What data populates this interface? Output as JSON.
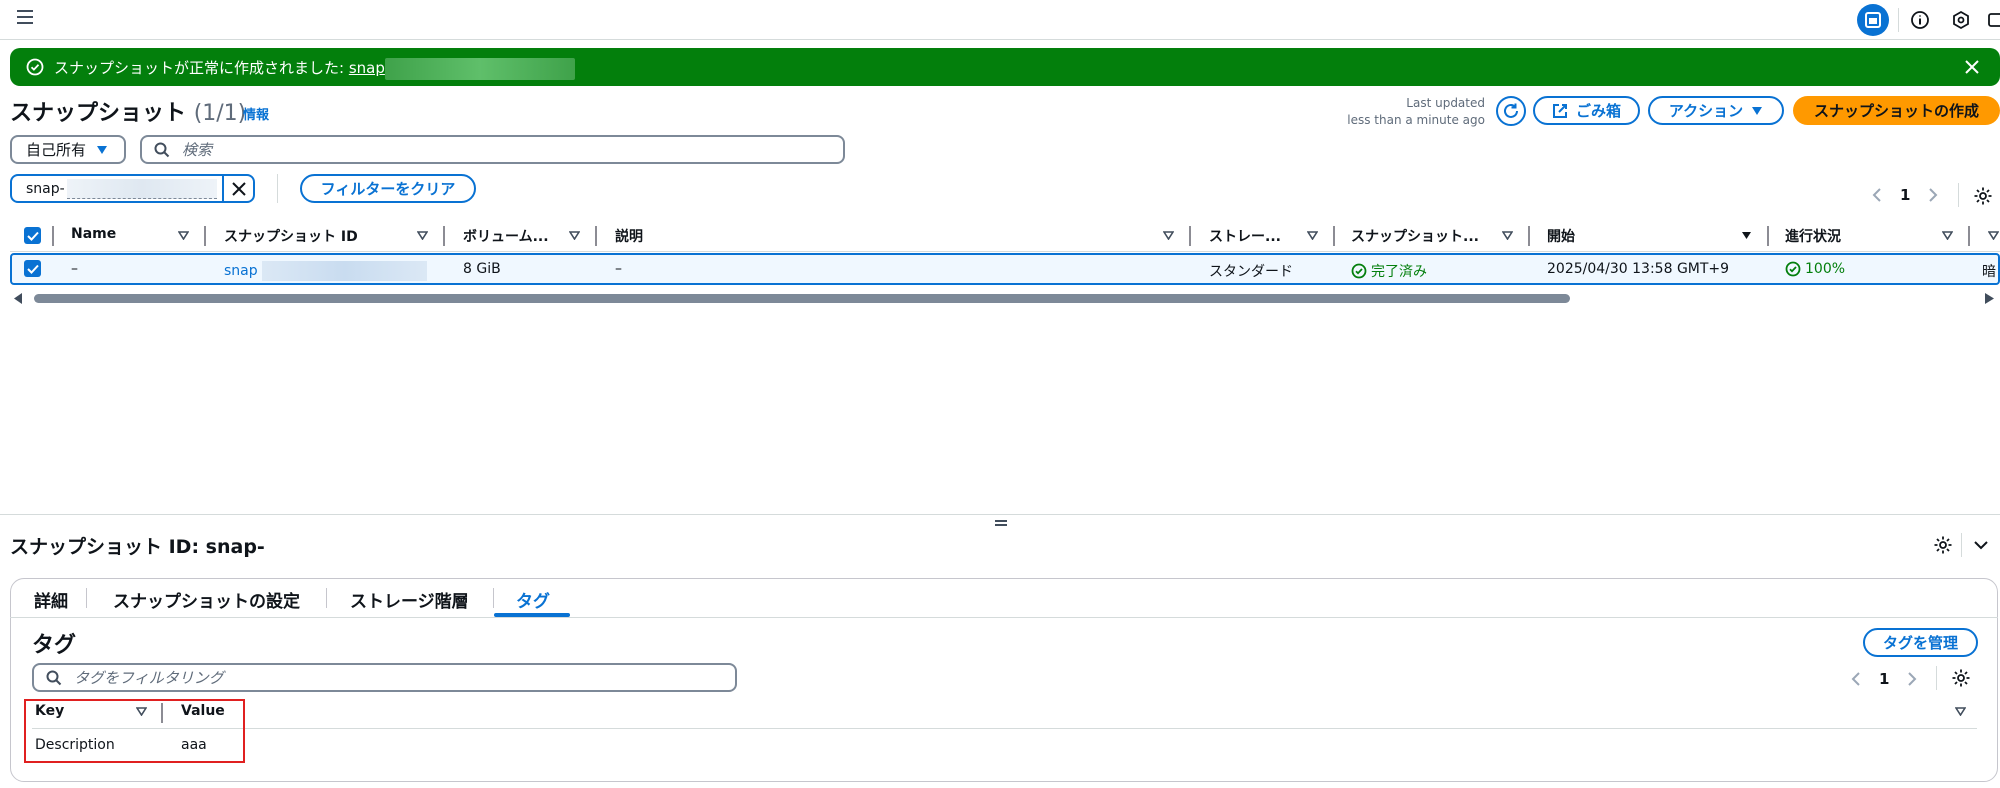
{
  "topbar": {
    "icons": [
      "menu-icon",
      "panel-icon",
      "info-icon",
      "hexagon-icon",
      "window-icon"
    ],
    "accent": "#0972d3"
  },
  "flash": {
    "message": "スナップショットが正常に作成されました: ",
    "link": "snap",
    "color": "#037f0c"
  },
  "header": {
    "title": "スナップショット",
    "count": "(1/1)",
    "info_link": "情報",
    "last_updated_label": "Last updated",
    "last_updated_value": "less than a minute ago",
    "recycle_bin_label": "ごみ箱",
    "actions_label": "アクション",
    "create_label": "スナップショットの作成",
    "create_color": "#ff9900"
  },
  "filters": {
    "owner_select": "自己所有",
    "search_placeholder": "検索",
    "token_prefix": "snap-",
    "clear_label": "フィルターをクリア"
  },
  "pagination": {
    "page": "1"
  },
  "table": {
    "columns": [
      "Name",
      "スナップショット ID",
      "ボリューム...",
      "説明",
      "ストレー...",
      "スナップショット...",
      "開始",
      "進行状況",
      ""
    ],
    "rows": [
      {
        "name": "–",
        "id_prefix": "snap",
        "volume_size": "8 GiB",
        "description": "–",
        "storage": "スタンダード",
        "status": "完了済み",
        "started": "2025/04/30 13:58 GMT+9",
        "progress": "100%",
        "truncated": "暗"
      }
    ]
  },
  "detail": {
    "title": "スナップショット ID: snap-",
    "tabs": [
      "詳細",
      "スナップショットの設定",
      "ストレージ階層",
      "タグ"
    ],
    "active_tab": "タグ",
    "tags_heading": "タグ",
    "manage_tags_label": "タグを管理",
    "tag_search_placeholder": "タグをフィルタリング",
    "page": "1",
    "columns": [
      "Key",
      "Value"
    ],
    "tags": [
      {
        "key": "Description",
        "value": "aaa"
      }
    ]
  }
}
